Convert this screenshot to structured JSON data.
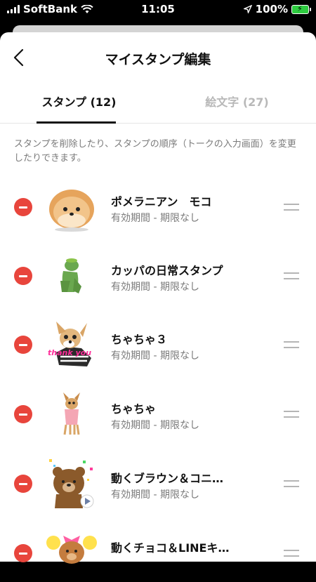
{
  "status_bar": {
    "carrier": "SoftBank",
    "time": "11:05",
    "battery": "100%"
  },
  "header": {
    "title": "マイスタンプ編集"
  },
  "tabs": [
    {
      "label": "スタンプ (12)",
      "active": true
    },
    {
      "label": "絵文字 (27)",
      "active": false
    }
  ],
  "description": "スタンプを削除したり、スタンプの順序（トークの入力画面）を変更したりできます。",
  "stamps": [
    {
      "name": "ポメラニアン　モコ",
      "period": "有効期間 - 期限なし"
    },
    {
      "name": "カッパの日常スタンプ",
      "period": "有効期間 - 期限なし"
    },
    {
      "name": "ちゃちゃ３",
      "period": "有効期間 - 期限なし"
    },
    {
      "name": "ちゃちゃ",
      "period": "有効期間 - 期限なし"
    },
    {
      "name": "動くブラウン＆コニ…",
      "period": "有効期間 - 期限なし"
    },
    {
      "name": "動くチョコ＆LINEキ…",
      "period": ""
    }
  ],
  "thumb_text": {
    "thank_you": "thank you"
  },
  "colors": {
    "remove": "#e8453c",
    "accent": "#111111",
    "muted": "#7a7a7a"
  }
}
